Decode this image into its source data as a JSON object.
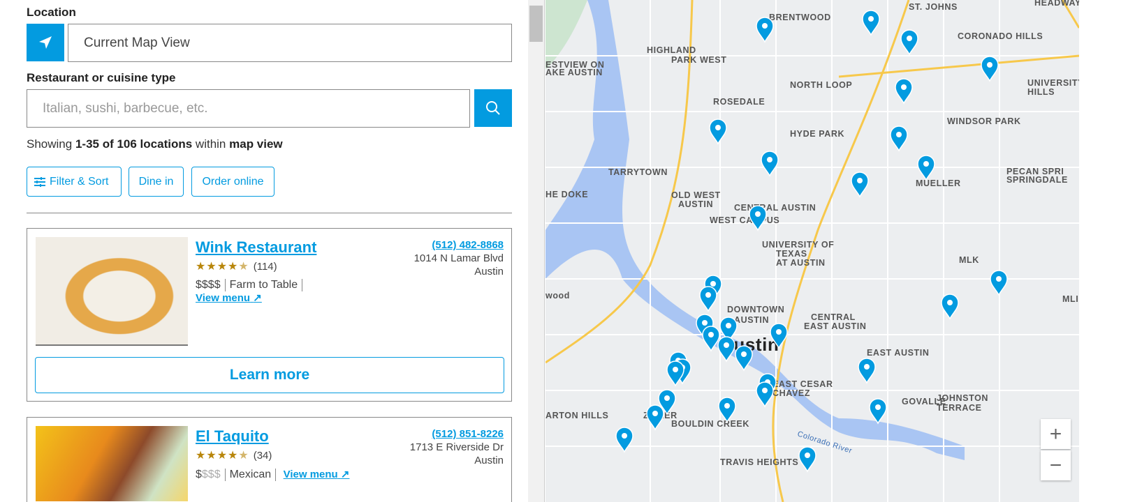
{
  "search": {
    "location_label": "Location",
    "location_value": "Current Map View",
    "cuisine_label": "Restaurant or cuisine type",
    "cuisine_placeholder": "Italian, sushi, barbecue, etc.",
    "showing_prefix": "Showing",
    "showing_range": "1-35 of 106 locations",
    "showing_mid": "within",
    "showing_scope": "map view"
  },
  "filters": [
    {
      "label": "Filter & Sort",
      "icon": "sliders-icon"
    },
    {
      "label": "Dine in"
    },
    {
      "label": "Order online"
    }
  ],
  "results": [
    {
      "name": "Wink Restaurant",
      "rating": 4.5,
      "review_count": "(114)",
      "price": "$$$$",
      "price_level": 4,
      "cuisine": "Farm to Table",
      "view_menu": "View menu",
      "phone": "(512) 482-8868",
      "address": "1014 N Lamar Blvd",
      "city": "Austin",
      "learn_more": "Learn more"
    },
    {
      "name": "El Taquito",
      "rating": 4.5,
      "review_count": "(34)",
      "price": "$$$$",
      "price_level": 1,
      "cuisine": "Mexican",
      "view_menu": "View menu",
      "phone": "(512) 851-8226",
      "address": "1713 E Riverside Dr",
      "city": "Austin"
    }
  ],
  "map": {
    "accent": "#039be0",
    "zoom_in": "+",
    "zoom_out": "−",
    "labels": [
      "BRENTWOOD",
      "ST. JOHNS",
      "HEADWAY",
      "HIGHLAND",
      "PARK WEST",
      "CORONADO HILLS",
      "NORTH LOOP",
      "UNIVERSITY",
      "HILLS",
      "ROSEDALE",
      "HYDE PARK",
      "WINDSOR PARK",
      "TARRYTOWN",
      "OLD WEST",
      "AUSTIN",
      "MUELLER",
      "PECAN SPRI",
      "SPRINGDALE",
      "CENTRAL AUSTIN",
      "WEST CAMPUS",
      "UNIVERSITY OF",
      "TEXAS",
      "AT AUSTIN",
      "MLK",
      "DOWNTOWN",
      "AUSTIN",
      "CENTRAL",
      "EAST AUSTIN",
      "Austin",
      "EAST AUSTIN",
      "EAST CESAR",
      "CHAVEZ",
      "GOVALLE",
      "JOHNSTON",
      "TERRACE",
      "ZILKER",
      "BOULDIN CREEK",
      "TRAVIS HEIGHTS",
      "ARTON HILLS",
      "ESTVIEW ON",
      "AKE AUSTIN",
      "HE DOKE",
      "wood",
      "Colorado River",
      "MLI"
    ]
  }
}
